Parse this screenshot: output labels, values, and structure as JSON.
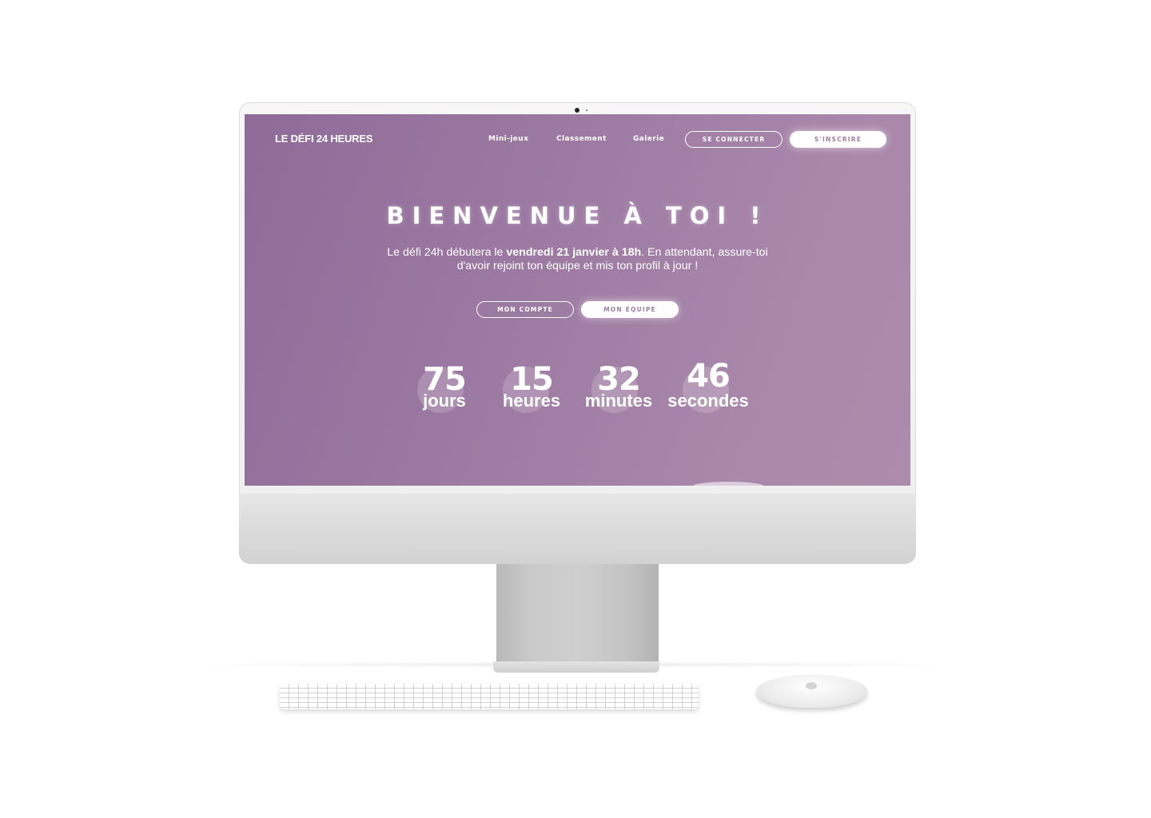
{
  "site": {
    "logo": "LE DÉFI 24 HEURES",
    "nav": {
      "links": [
        "Mini-jeux",
        "Classement",
        "Galerie"
      ],
      "login_label": "SE CONNECTER",
      "signup_label": "S'INSCRIRE"
    },
    "hero": {
      "title": "BIENVENUE À TOI !",
      "text_before": "Le défi 24h débutera le ",
      "text_bold": "vendredi 21 janvier à 18h",
      "text_after": ". En attendant, assure-toi d'avoir rejoint ton équipe et mis ton profil à jour !",
      "account_label": "MON COMPTE",
      "team_label": "MON ÉQUIPE"
    },
    "countdown": [
      {
        "value": "75",
        "unit": "jours"
      },
      {
        "value": "15",
        "unit": "heures"
      },
      {
        "value": "32",
        "unit": "minutes"
      },
      {
        "value": "46",
        "unit": "secondes"
      }
    ]
  },
  "colors": {
    "hero_start": "#8f6b98",
    "hero_end": "#ac8bad",
    "button_text": "#a07fa6"
  },
  "icons": [
    "camera-icon",
    "apple-logo-icon"
  ]
}
